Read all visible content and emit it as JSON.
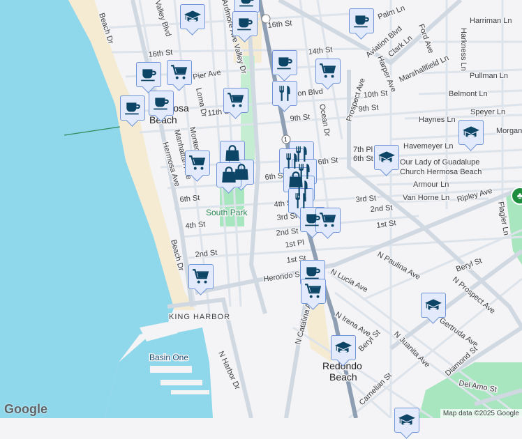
{
  "map": {
    "water_color": "#8fd7ea",
    "sand_color": "#f5ebd2",
    "park_color": "#a8e6bf",
    "road_color": "#d6dde6",
    "highway_color": "#8f9fb3",
    "marker_icon_color": "#0d4566"
  },
  "labels": {
    "places": {
      "hermosa": "Hermosa",
      "hermosa_beach": "Beach",
      "redondo": "Redondo",
      "redondo_beach": "Beach",
      "south_park": "South Park",
      "king_harbor": "KING HARBOR",
      "basin_one": "Basin One",
      "church1": "Our Lady of Guadalupe",
      "church2": "Church Hermosa Beach"
    },
    "streets": {
      "beach_dr_n": "Beach Dr",
      "valley_blvd": "Valley Blvd",
      "ardmore_valley": "Ardmore Ave Valley Dr",
      "st16_w": "16th St",
      "st16_e": "16th St",
      "st14": "14th St",
      "pier_ave": "Pier Ave",
      "loma": "Loma Dr",
      "st11": "11th St",
      "aviation_e": "Aviation Blvd",
      "aviation_w": "Aviation Blvd",
      "palm": "Palm Ln",
      "harriman": "Harriman Ln",
      "clark": "Clark Ln",
      "ford": "Ford Ave",
      "harkness": "Harkness Ln",
      "harper": "Harper Ave",
      "marshallfield": "Marshallfield Ln",
      "pullman": "Pullman Ln",
      "prospect": "Prospect Ave",
      "st10": "10th St",
      "belmont": "Belmont Ln",
      "st9_e": "9th St",
      "st9_w": "9th St",
      "speyer": "Speyer Ln",
      "haynes": "Haynes Ln",
      "ocean": "Ocean Dr",
      "morgan": "Morgan Ln",
      "havemeyer": "Havemeyer Ln",
      "pl7": "7th Pl",
      "st6_e": "6th St",
      "st6_m": "6th St",
      "st6_w": "6th St",
      "armour": "Armour Ln",
      "van_horne": "Van Horne Ln",
      "ripley": "Ripley Ave",
      "flagler": "Flagler Ln",
      "st3_e": "3rd St",
      "st3_w": "3rd St",
      "st4_m": "4th St",
      "st4_w": "4th St",
      "st2_e": "2nd St",
      "st2_m": "2nd St",
      "st2_w": "2nd St",
      "st1_e": "1st St",
      "pl1": "1st Pl",
      "st1_w": "1st St",
      "hermosa_ave": "Hermosa Ave",
      "manhattan": "Manhattan Ave",
      "monterey": "Monterey Blvd",
      "beach_dr_s": "Beach Dr",
      "herondo": "Herondo St",
      "paulina": "N Paulina Ave",
      "beryl_e": "Beryl St",
      "beryl_w": "Beryl St",
      "n_prospect": "N Prospect Ave",
      "lucia": "N Lucia Ave",
      "catalina": "N Catalina Ave",
      "irena": "N Irena Ave",
      "juanita": "N Juanita Ave",
      "gertruda": "N Gertruda Ave",
      "diamond": "Diamond St",
      "del_amo": "Del Amo St",
      "carnelian": "Carnelian St",
      "harbor": "N Harbor Dr",
      "route_1": "1"
    }
  },
  "markers": [
    {
      "type": "school",
      "icon": "graduation-cap-icon"
    },
    {
      "type": "cafe",
      "icon": "coffee-cup-icon"
    },
    {
      "type": "cafe",
      "icon": "coffee-cup-icon"
    },
    {
      "type": "cafe",
      "icon": "coffee-cup-icon"
    },
    {
      "type": "cart",
      "icon": "shopping-cart-icon"
    },
    {
      "type": "cafe",
      "icon": "coffee-cup-icon"
    },
    {
      "type": "cafe",
      "icon": "coffee-cup-icon"
    },
    {
      "type": "cart",
      "icon": "shopping-cart-icon"
    },
    {
      "type": "cafe",
      "icon": "coffee-cup-icon"
    },
    {
      "type": "cart",
      "icon": "shopping-cart-icon"
    },
    {
      "type": "restaurant",
      "icon": "fork-knife-icon"
    },
    {
      "type": "cart",
      "icon": "shopping-cart-icon"
    },
    {
      "type": "shop",
      "icon": "shopping-bag-icon"
    },
    {
      "type": "shop",
      "icon": "shopping-bag-icon"
    },
    {
      "type": "shop",
      "icon": "shopping-bag-icon"
    },
    {
      "type": "restaurant",
      "icon": "fork-knife-icon"
    },
    {
      "type": "school",
      "icon": "graduation-cap-icon"
    },
    {
      "type": "school",
      "icon": "graduation-cap-icon"
    },
    {
      "type": "cafe",
      "icon": "coffee-cup-icon"
    },
    {
      "type": "cart",
      "icon": "shopping-cart-icon"
    },
    {
      "type": "cafe",
      "icon": "coffee-cup-icon"
    },
    {
      "type": "cart",
      "icon": "shopping-cart-icon"
    },
    {
      "type": "cart",
      "icon": "shopping-cart-icon"
    },
    {
      "type": "school",
      "icon": "graduation-cap-icon"
    },
    {
      "type": "school",
      "icon": "graduation-cap-icon"
    },
    {
      "type": "school",
      "icon": "graduation-cap-icon"
    }
  ],
  "footer": {
    "logo": "Google",
    "attribution": "Map data ©2025 Google"
  }
}
